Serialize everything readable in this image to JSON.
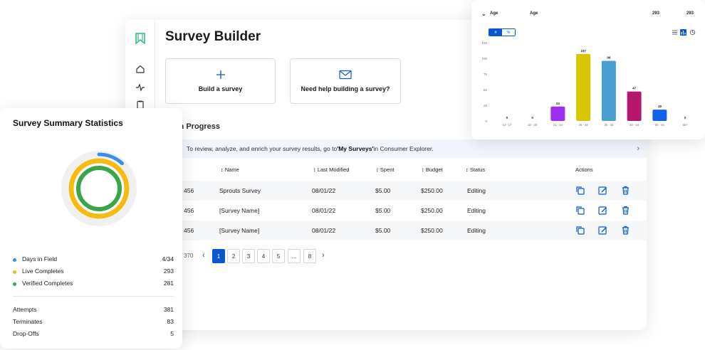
{
  "app": {
    "title": "Survey Builder",
    "cards": [
      {
        "label": "Build a survey",
        "icon": "plus-icon"
      },
      {
        "label": "Need help building a survey?",
        "icon": "mail-icon"
      }
    ],
    "section_title": "ng in Progress",
    "banner": {
      "prefix": "To review, analyze, and enrich your survey results, go to ",
      "bold": "'My Surveys'",
      "suffix": " in Consumer Explorer."
    },
    "table": {
      "headers": [
        "Name",
        "Last Modified",
        "Spent",
        "Budget",
        "Status",
        "Actions"
      ],
      "rows": [
        {
          "id": "456",
          "name": "Sprouts Survey",
          "modified": "08/01/22",
          "spent": "$5.00",
          "budget": "$250.00",
          "status": "Editing"
        },
        {
          "id": "456",
          "name": "[Survey Name]",
          "modified": "08/01/22",
          "spent": "$5.00",
          "budget": "$250.00",
          "status": "Editing"
        },
        {
          "id": "456",
          "name": "[Survey Name]",
          "modified": "08/01/22",
          "spent": "$5.00",
          "budget": "$250.00",
          "status": "Editing"
        }
      ]
    },
    "pager": {
      "count": "370",
      "pages": [
        "1",
        "2",
        "3",
        "4",
        "5",
        "...",
        "8"
      ],
      "active": "1"
    }
  },
  "summary": {
    "title": "Survey Summary Statistics",
    "legend": [
      {
        "label": "Days in Field",
        "value": "4/34",
        "color": "#3b8ee8"
      },
      {
        "label": "Live Completes",
        "value": "293",
        "color": "#f4bb12"
      },
      {
        "label": "Verified Completes",
        "value": "281",
        "color": "#3aa64a"
      }
    ],
    "stats": [
      {
        "label": "Attempts",
        "value": "381"
      },
      {
        "label": "Terminates",
        "value": "83"
      },
      {
        "label": "Drop-Offs",
        "value": "5"
      }
    ],
    "donut": {
      "days_fraction": 0.118,
      "live_fraction": 1.0,
      "verified_fraction": 1.0
    }
  },
  "age_panel": {
    "title": "Age",
    "column": "Age",
    "total_1": "293",
    "total_2": "293",
    "toggle": [
      "#",
      "%"
    ],
    "chart_data": {
      "type": "bar",
      "categories": [
        "13 - 17",
        "18 - 20",
        "21 - 24",
        "25 - 34",
        "35 - 44",
        "45 - 54",
        "55 - 64",
        "65+"
      ],
      "values": [
        0,
        0,
        23,
        107,
        96,
        47,
        18,
        0
      ],
      "colors": [
        "#999999",
        "#999999",
        "#9b30f0",
        "#d8c700",
        "#4a9fd0",
        "#b5176f",
        "#1460e6",
        "#999999"
      ],
      "ylim": [
        0,
        125
      ],
      "yticks": [
        0,
        25,
        50,
        75,
        100,
        125
      ],
      "xlabel": "",
      "ylabel": "",
      "grid": false
    }
  }
}
